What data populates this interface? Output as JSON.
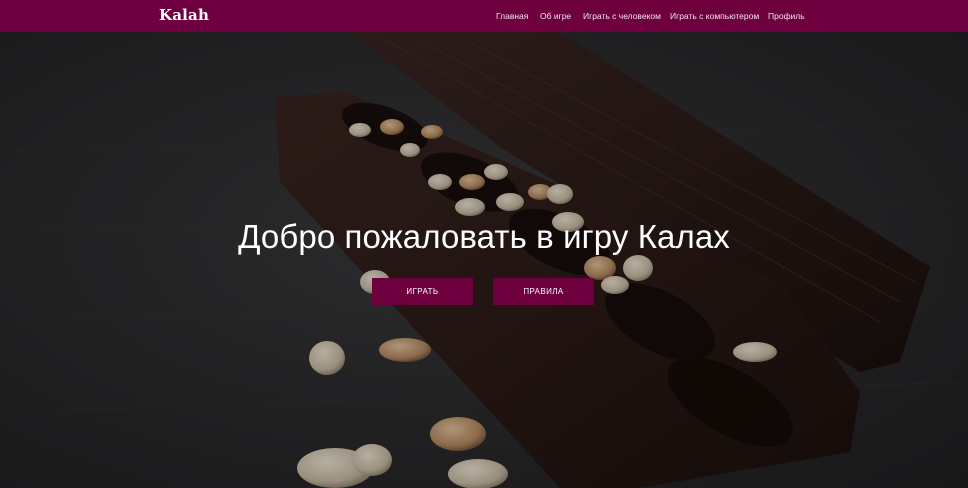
{
  "brand": "Kalah",
  "nav": {
    "items": [
      {
        "label": "Главная"
      },
      {
        "label": "Об игре"
      },
      {
        "label": "Играть с человеком"
      },
      {
        "label": "Играть с компьютером"
      },
      {
        "label": "Профиль"
      }
    ]
  },
  "hero": {
    "title": "Добро пожаловать в игру Калах",
    "play_button": "ИГРАТЬ",
    "rules_button": "ПРАВИЛА",
    "background": "kalah-board-with-stones-photo"
  },
  "colors": {
    "accent": "#6f0040",
    "text_light": "#ffffff",
    "backdrop": "#2b2a2b"
  }
}
